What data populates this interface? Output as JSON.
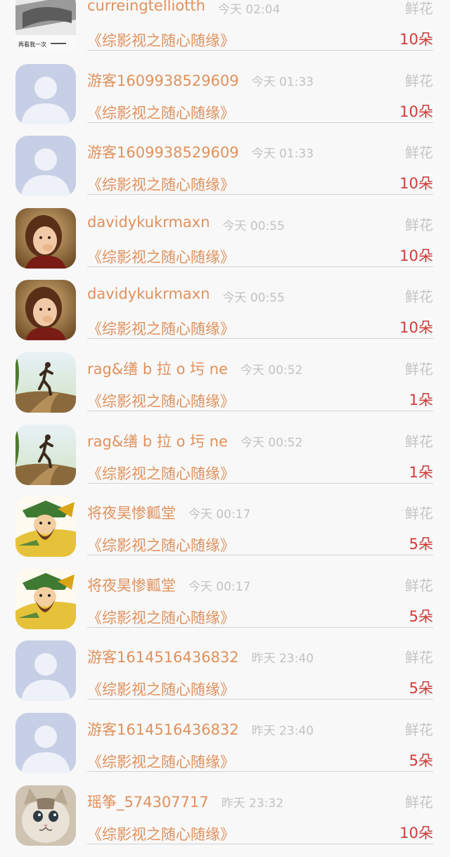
{
  "rows": [
    {
      "name": "curreingtelliotth",
      "time": "今天 02:04",
      "gift": "鲜花",
      "program": "《综影视之随心随缘》",
      "amount": "10朵",
      "avatar": "photo-bw",
      "avatar_caption": "再看我一次"
    },
    {
      "name": "游客1609938529609",
      "time": "今天 01:33",
      "gift": "鲜花",
      "program": "《综影视之随心随缘》",
      "amount": "10朵",
      "avatar": "default"
    },
    {
      "name": "游客1609938529609",
      "time": "今天 01:33",
      "gift": "鲜花",
      "program": "《综影视之随心随缘》",
      "amount": "10朵",
      "avatar": "default"
    },
    {
      "name": "davidykukrmaxn",
      "time": "今天 00:55",
      "gift": "鲜花",
      "program": "《综影视之随心随缘》",
      "amount": "10朵",
      "avatar": "girl"
    },
    {
      "name": "davidykukrmaxn",
      "time": "今天 00:55",
      "gift": "鲜花",
      "program": "《综影视之随心随缘》",
      "amount": "10朵",
      "avatar": "girl"
    },
    {
      "name": "rag&缮 b 拉 o 圬 ne",
      "time": "今天 00:52",
      "gift": "鲜花",
      "program": "《综影视之随心随缘》",
      "amount": "1朵",
      "avatar": "runner"
    },
    {
      "name": "rag&缮 b 拉 o 圬 ne",
      "time": "今天 00:52",
      "gift": "鲜花",
      "program": "《综影视之随心随缘》",
      "amount": "1朵",
      "avatar": "runner"
    },
    {
      "name": "将夜昊惨瓤堂",
      "time": "今天 00:17",
      "gift": "鲜花",
      "program": "《综影视之随心随缘》",
      "amount": "5朵",
      "avatar": "warrior"
    },
    {
      "name": "将夜昊惨瓤堂",
      "time": "今天 00:17",
      "gift": "鲜花",
      "program": "《综影视之随心随缘》",
      "amount": "5朵",
      "avatar": "warrior"
    },
    {
      "name": "游客1614516436832",
      "time": "昨天 23:40",
      "gift": "鲜花",
      "program": "《综影视之随心随缘》",
      "amount": "5朵",
      "avatar": "default"
    },
    {
      "name": "游客1614516436832",
      "time": "昨天 23:40",
      "gift": "鲜花",
      "program": "《综影视之随心随缘》",
      "amount": "5朵",
      "avatar": "default"
    },
    {
      "name": "瑶筝_574307717",
      "time": "昨天 23:32",
      "gift": "鲜花",
      "program": "《综影视之随心随缘》",
      "amount": "10朵",
      "avatar": "kitten"
    }
  ],
  "colors": {
    "name": "#e0915c",
    "amount": "#d23a3a",
    "muted": "#c2c2c2",
    "divider": "#d2d2d2",
    "background": "#f8f8f8"
  }
}
